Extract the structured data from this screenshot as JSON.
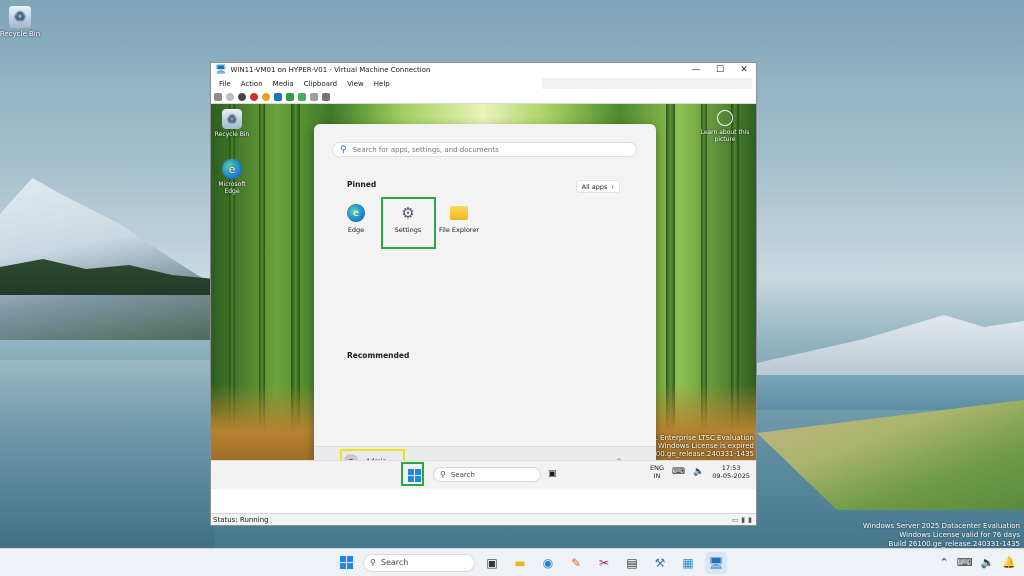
{
  "host": {
    "desktop_icons": [
      {
        "label": "Recycle Bin",
        "icon": "recycle-bin-icon"
      }
    ],
    "watermark": [
      "Windows Server 2025 Datacenter Evaluation",
      "Windows License valid for 76 days",
      "Build 26100.ge_release.240331-1435"
    ],
    "taskbar": {
      "search_label": "Search",
      "apps": [
        "task-view-icon",
        "file-explorer-icon",
        "edge-icon",
        "paint-icon",
        "snipping-icon",
        "terminal-icon",
        "tool-icon",
        "store-icon",
        "vm-connection-icon"
      ],
      "tray": [
        "chevron-up-icon",
        "network-icon",
        "volume-icon",
        "notification-icon"
      ]
    }
  },
  "vm_window": {
    "title": "WIN11-VM01 on HYPER-V01 - Virtual Machine Connection",
    "controls": [
      "—",
      "☐",
      "✕"
    ],
    "menu": [
      "File",
      "Action",
      "Media",
      "Clipboard",
      "View",
      "Help"
    ],
    "status": "Status: Running"
  },
  "guest": {
    "desktop_icons": [
      {
        "label": "Recycle Bin",
        "icon": "recycle-bin-icon"
      },
      {
        "label": "Microsoft Edge",
        "icon": "edge-icon"
      }
    ],
    "learn_about": "Learn about this picture",
    "watermark": [
      "dows 11 Enterprise LTSC Evaluation",
      "Windows License is expired",
      "Build 26100.ge_release.240331-1435"
    ],
    "start_menu": {
      "search_placeholder": "Search for apps, settings, and documents",
      "pinned_title": "Pinned",
      "all_apps_label": "All apps",
      "pinned": [
        {
          "label": "Edge",
          "icon": "edge-icon"
        },
        {
          "label": "Settings",
          "icon": "settings-gear-icon"
        },
        {
          "label": "File Explorer",
          "icon": "file-explorer-icon"
        }
      ],
      "recommended_title": "Recommended",
      "user": "Admin"
    },
    "taskbar": {
      "search_label": "Search",
      "lang": "ENG",
      "region": "IN",
      "time": "17:53",
      "date": "09-05-2025"
    }
  },
  "colors": {
    "highlight_green": "#28a745",
    "highlight_yellow": "#e9e223",
    "accent": "#1e88e5"
  }
}
